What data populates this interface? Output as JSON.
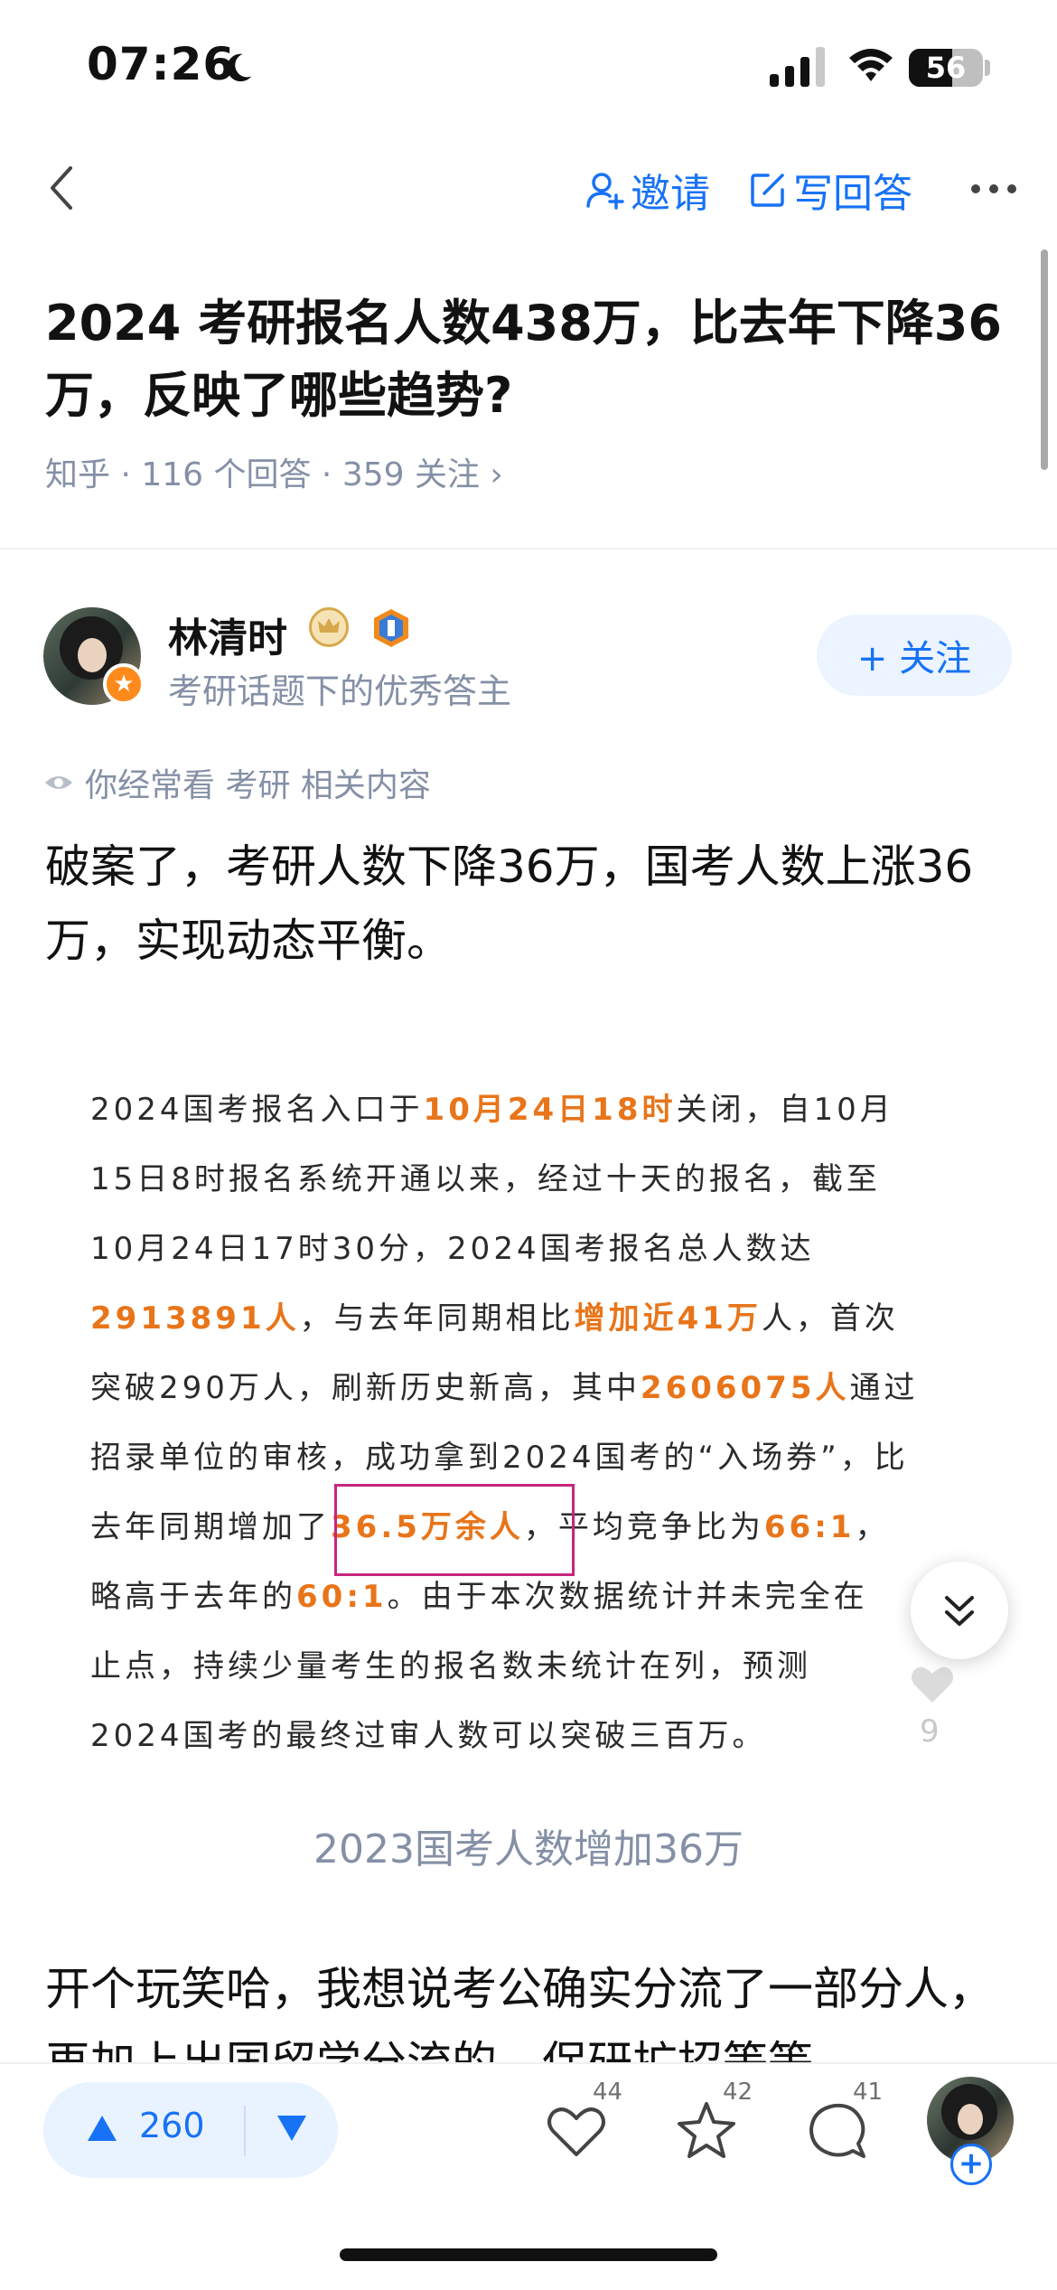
{
  "status_bar": {
    "time": "07:26",
    "battery": "56"
  },
  "nav": {
    "invite_label": "邀请",
    "write_label": "写回答"
  },
  "question": {
    "title": "2024 考研报名人数438万，比去年下降36万，反映了哪些趋势?",
    "meta": "知乎 · 116 个回答 · 359 关注 ›"
  },
  "author": {
    "name": "林清时",
    "desc": "考研话题下的优秀答主",
    "follow_label": "+ 关注"
  },
  "hint": "你经常看 考研 相关内容",
  "answer": {
    "para1": "破案了，考研人数下降36万，国考人数上涨36万，实现动态平衡。",
    "image_lines": [
      [
        {
          "t": "2024国考报名入口于"
        },
        {
          "t": "10月24日18时",
          "h": true
        },
        {
          "t": "关闭，自10月"
        }
      ],
      [
        {
          "t": "15日8时报名系统开通以来，经过十天的报名，截至"
        }
      ],
      [
        {
          "t": "10月24日17时30分，2024国考报名总人数达"
        }
      ],
      [
        {
          "t": "2913891人",
          "h": true
        },
        {
          "t": "，与去年同期相比"
        },
        {
          "t": "增加近41万",
          "h": true
        },
        {
          "t": "人，首次"
        }
      ],
      [
        {
          "t": "突破290万人，刷新历史新高，其中"
        },
        {
          "t": "2606075人",
          "h": true
        },
        {
          "t": "通过"
        }
      ],
      [
        {
          "t": "招录单位的审核，成功拿到2024国考的“入场券”，比"
        }
      ],
      [
        {
          "t": "去年同期增加了"
        },
        {
          "t": "36.5万余人",
          "h": true
        },
        {
          "t": "，平均竞争比为"
        },
        {
          "t": "66:1",
          "h": true
        },
        {
          "t": "，"
        }
      ],
      [
        {
          "t": "略高于去年的"
        },
        {
          "t": "60:1",
          "h": true
        },
        {
          "t": "。由于本次数据统计并未完全在"
        }
      ],
      [
        {
          "t": "止点，持续少量考生的报名数未统计在列，预测"
        }
      ],
      [
        {
          "t": "2024国考的最终过审人数可以突破三百万。"
        }
      ]
    ],
    "caption": "2023国考人数增加36万",
    "para2": "开个玩笑哈，我想说考公确实分流了一部分人，再加上出国留学分流的，保研扩招等等"
  },
  "floating": {
    "count": "9"
  },
  "bottom_bar": {
    "vote_count": "260",
    "like_count": "44",
    "fav_count": "42",
    "comment_count": "41"
  },
  "colors": {
    "accent": "#1772f6",
    "highlight": "#e8751a",
    "box": "#c7267e",
    "muted": "#8590a6"
  }
}
